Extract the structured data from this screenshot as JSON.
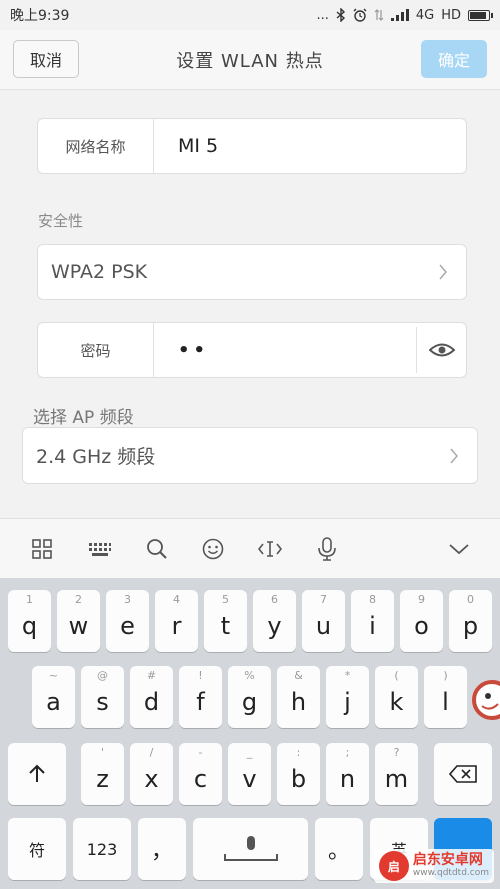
{
  "status": {
    "time": "晚上9:39",
    "dots": "...",
    "network": "4G",
    "hd": "HD"
  },
  "header": {
    "cancel_label": "取消",
    "title": "设置 WLAN 热点",
    "ok_label": "确定"
  },
  "form": {
    "ssid_label": "网络名称",
    "ssid_value": "MI 5",
    "security_section": "安全性",
    "security_value": "WPA2 PSK",
    "password_label": "密码",
    "password_value": "••",
    "band_section": "选择 AP 频段",
    "band_value": "2.4 GHz 频段"
  },
  "toolbar": {
    "icons": [
      "grid-icon",
      "keyboard-icon",
      "search-icon",
      "emoji-icon",
      "cursor-icon",
      "microphone-icon",
      "collapse-chevron-icon"
    ]
  },
  "keyboard": {
    "row1": [
      {
        "key": "q",
        "hint": "1"
      },
      {
        "key": "w",
        "hint": "2"
      },
      {
        "key": "e",
        "hint": "3"
      },
      {
        "key": "r",
        "hint": "4"
      },
      {
        "key": "t",
        "hint": "5"
      },
      {
        "key": "y",
        "hint": "6"
      },
      {
        "key": "u",
        "hint": "7"
      },
      {
        "key": "i",
        "hint": "8"
      },
      {
        "key": "o",
        "hint": "9"
      },
      {
        "key": "p",
        "hint": "0"
      }
    ],
    "row2": [
      {
        "key": "a",
        "hint": "~"
      },
      {
        "key": "s",
        "hint": "@"
      },
      {
        "key": "d",
        "hint": "#"
      },
      {
        "key": "f",
        "hint": "!"
      },
      {
        "key": "g",
        "hint": "%"
      },
      {
        "key": "h",
        "hint": "&"
      },
      {
        "key": "j",
        "hint": "*"
      },
      {
        "key": "k",
        "hint": "("
      },
      {
        "key": "l",
        "hint": ")"
      }
    ],
    "row3": [
      {
        "key": "z",
        "hint": "'"
      },
      {
        "key": "x",
        "hint": "/"
      },
      {
        "key": "c",
        "hint": "-"
      },
      {
        "key": "v",
        "hint": "_"
      },
      {
        "key": "b",
        "hint": ":"
      },
      {
        "key": "n",
        "hint": ";"
      },
      {
        "key": "m",
        "hint": "?"
      }
    ],
    "symbols_label": "符",
    "numbers_label": "123",
    "comma_label": "，",
    "period_label": "。",
    "lang_label": "英"
  },
  "watermark": {
    "name": "启东安卓网",
    "url": "www.qdtdtd.com"
  },
  "colors": {
    "accent": "#1a8ce8",
    "ok_button": "#a7d7f4"
  }
}
